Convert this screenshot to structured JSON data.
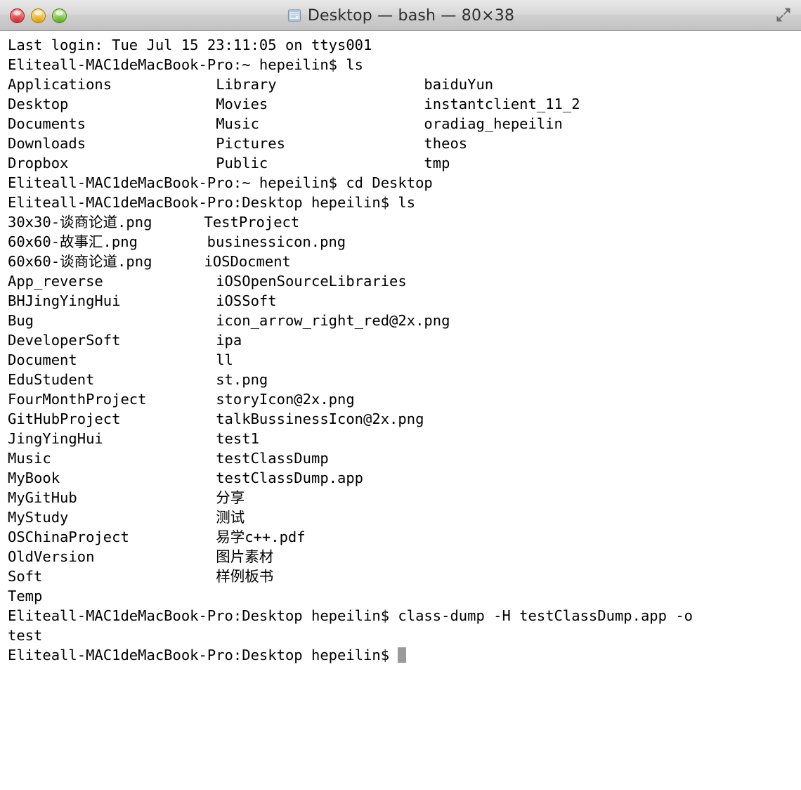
{
  "window": {
    "title": "Desktop — bash — 80×38",
    "title_icon": "terminal-document-icon",
    "controls": {
      "close": "close-button",
      "minimize": "minimize-button",
      "zoom": "zoom-button",
      "fullscreen": "fullscreen-button"
    }
  },
  "terminal": {
    "columns": 80,
    "rows": 38,
    "column_width_chars": 24,
    "cursor": "block",
    "lines": [
      {
        "type": "text",
        "text": "Last login: Tue Jul 15 23:11:05 on ttys001"
      },
      {
        "type": "prompt",
        "text": "Eliteall-MAC1deMacBook-Pro:~ hepeilin$ ls"
      },
      {
        "type": "cols",
        "c1": "Applications",
        "c2": "Library",
        "c3": "baiduYun"
      },
      {
        "type": "cols",
        "c1": "Desktop",
        "c2": "Movies",
        "c3": "instantclient_11_2"
      },
      {
        "type": "cols",
        "c1": "Documents",
        "c2": "Music",
        "c3": "oradiag_hepeilin"
      },
      {
        "type": "cols",
        "c1": "Downloads",
        "c2": "Pictures",
        "c3": "theos"
      },
      {
        "type": "cols",
        "c1": "Dropbox",
        "c2": "Public",
        "c3": "tmp"
      },
      {
        "type": "prompt",
        "text": "Eliteall-MAC1deMacBook-Pro:~ hepeilin$ cd Desktop"
      },
      {
        "type": "prompt",
        "text": "Eliteall-MAC1deMacBook-Pro:Desktop hepeilin$ ls"
      },
      {
        "type": "cols",
        "c1": "30x30-谈商论道.png",
        "c2": "TestProject",
        "c3": ""
      },
      {
        "type": "cols",
        "c1": "60x60-故事汇.png",
        "c2": "businessicon.png",
        "c3": ""
      },
      {
        "type": "cols",
        "c1": "60x60-谈商论道.png",
        "c2": "iOSDocment",
        "c3": ""
      },
      {
        "type": "cols",
        "c1": "App_reverse",
        "c2": "iOSOpenSourceLibraries",
        "c3": ""
      },
      {
        "type": "cols",
        "c1": "BHJingYingHui",
        "c2": "iOSSoft",
        "c3": ""
      },
      {
        "type": "cols",
        "c1": "Bug",
        "c2": "icon_arrow_right_red@2x.png",
        "c3": ""
      },
      {
        "type": "cols",
        "c1": "DeveloperSoft",
        "c2": "ipa",
        "c3": ""
      },
      {
        "type": "cols",
        "c1": "Document",
        "c2": "ll",
        "c3": ""
      },
      {
        "type": "cols",
        "c1": "EduStudent",
        "c2": "st.png",
        "c3": ""
      },
      {
        "type": "cols",
        "c1": "FourMonthProject",
        "c2": "storyIcon@2x.png",
        "c3": ""
      },
      {
        "type": "cols",
        "c1": "GitHubProject",
        "c2": "talkBussinessIcon@2x.png",
        "c3": ""
      },
      {
        "type": "cols",
        "c1": "JingYingHui",
        "c2": "test1",
        "c3": ""
      },
      {
        "type": "cols",
        "c1": "Music",
        "c2": "testClassDump",
        "c3": ""
      },
      {
        "type": "cols",
        "c1": "MyBook",
        "c2": "testClassDump.app",
        "c3": ""
      },
      {
        "type": "cols",
        "c1": "MyGitHub",
        "c2": "分享",
        "c3": ""
      },
      {
        "type": "cols",
        "c1": "MyStudy",
        "c2": "测试",
        "c3": ""
      },
      {
        "type": "cols",
        "c1": "OSChinaProject",
        "c2": "易学c++.pdf",
        "c3": ""
      },
      {
        "type": "cols",
        "c1": "OldVersion",
        "c2": "图片素材",
        "c3": ""
      },
      {
        "type": "cols",
        "c1": "Soft",
        "c2": "样例板书",
        "c3": ""
      },
      {
        "type": "cols",
        "c1": "Temp",
        "c2": "",
        "c3": ""
      },
      {
        "type": "prompt",
        "text": "Eliteall-MAC1deMacBook-Pro:Desktop hepeilin$ class-dump -H testClassDump.app -o"
      },
      {
        "type": "text",
        "text": "test"
      },
      {
        "type": "prompt-cursor",
        "text": "Eliteall-MAC1deMacBook-Pro:Desktop hepeilin$ "
      }
    ]
  }
}
